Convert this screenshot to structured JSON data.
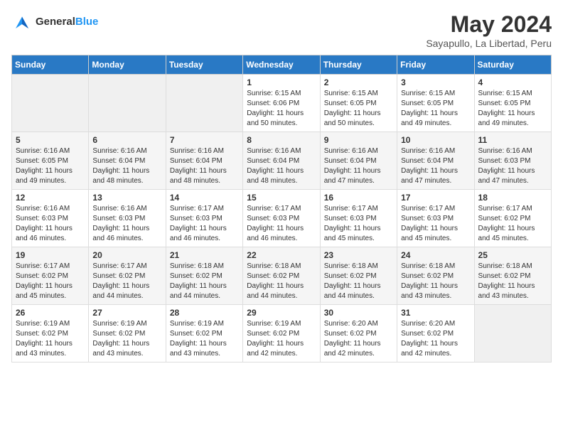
{
  "logo": {
    "text_general": "General",
    "text_blue": "Blue"
  },
  "header": {
    "title": "May 2024",
    "location": "Sayapullo, La Libertad, Peru"
  },
  "weekdays": [
    "Sunday",
    "Monday",
    "Tuesday",
    "Wednesday",
    "Thursday",
    "Friday",
    "Saturday"
  ],
  "weeks": [
    [
      {
        "day": "",
        "info": ""
      },
      {
        "day": "",
        "info": ""
      },
      {
        "day": "",
        "info": ""
      },
      {
        "day": "1",
        "info": "Sunrise: 6:15 AM\nSunset: 6:06 PM\nDaylight: 11 hours\nand 50 minutes."
      },
      {
        "day": "2",
        "info": "Sunrise: 6:15 AM\nSunset: 6:05 PM\nDaylight: 11 hours\nand 50 minutes."
      },
      {
        "day": "3",
        "info": "Sunrise: 6:15 AM\nSunset: 6:05 PM\nDaylight: 11 hours\nand 49 minutes."
      },
      {
        "day": "4",
        "info": "Sunrise: 6:15 AM\nSunset: 6:05 PM\nDaylight: 11 hours\nand 49 minutes."
      }
    ],
    [
      {
        "day": "5",
        "info": "Sunrise: 6:16 AM\nSunset: 6:05 PM\nDaylight: 11 hours\nand 49 minutes."
      },
      {
        "day": "6",
        "info": "Sunrise: 6:16 AM\nSunset: 6:04 PM\nDaylight: 11 hours\nand 48 minutes."
      },
      {
        "day": "7",
        "info": "Sunrise: 6:16 AM\nSunset: 6:04 PM\nDaylight: 11 hours\nand 48 minutes."
      },
      {
        "day": "8",
        "info": "Sunrise: 6:16 AM\nSunset: 6:04 PM\nDaylight: 11 hours\nand 48 minutes."
      },
      {
        "day": "9",
        "info": "Sunrise: 6:16 AM\nSunset: 6:04 PM\nDaylight: 11 hours\nand 47 minutes."
      },
      {
        "day": "10",
        "info": "Sunrise: 6:16 AM\nSunset: 6:04 PM\nDaylight: 11 hours\nand 47 minutes."
      },
      {
        "day": "11",
        "info": "Sunrise: 6:16 AM\nSunset: 6:03 PM\nDaylight: 11 hours\nand 47 minutes."
      }
    ],
    [
      {
        "day": "12",
        "info": "Sunrise: 6:16 AM\nSunset: 6:03 PM\nDaylight: 11 hours\nand 46 minutes."
      },
      {
        "day": "13",
        "info": "Sunrise: 6:16 AM\nSunset: 6:03 PM\nDaylight: 11 hours\nand 46 minutes."
      },
      {
        "day": "14",
        "info": "Sunrise: 6:17 AM\nSunset: 6:03 PM\nDaylight: 11 hours\nand 46 minutes."
      },
      {
        "day": "15",
        "info": "Sunrise: 6:17 AM\nSunset: 6:03 PM\nDaylight: 11 hours\nand 46 minutes."
      },
      {
        "day": "16",
        "info": "Sunrise: 6:17 AM\nSunset: 6:03 PM\nDaylight: 11 hours\nand 45 minutes."
      },
      {
        "day": "17",
        "info": "Sunrise: 6:17 AM\nSunset: 6:03 PM\nDaylight: 11 hours\nand 45 minutes."
      },
      {
        "day": "18",
        "info": "Sunrise: 6:17 AM\nSunset: 6:02 PM\nDaylight: 11 hours\nand 45 minutes."
      }
    ],
    [
      {
        "day": "19",
        "info": "Sunrise: 6:17 AM\nSunset: 6:02 PM\nDaylight: 11 hours\nand 45 minutes."
      },
      {
        "day": "20",
        "info": "Sunrise: 6:17 AM\nSunset: 6:02 PM\nDaylight: 11 hours\nand 44 minutes."
      },
      {
        "day": "21",
        "info": "Sunrise: 6:18 AM\nSunset: 6:02 PM\nDaylight: 11 hours\nand 44 minutes."
      },
      {
        "day": "22",
        "info": "Sunrise: 6:18 AM\nSunset: 6:02 PM\nDaylight: 11 hours\nand 44 minutes."
      },
      {
        "day": "23",
        "info": "Sunrise: 6:18 AM\nSunset: 6:02 PM\nDaylight: 11 hours\nand 44 minutes."
      },
      {
        "day": "24",
        "info": "Sunrise: 6:18 AM\nSunset: 6:02 PM\nDaylight: 11 hours\nand 43 minutes."
      },
      {
        "day": "25",
        "info": "Sunrise: 6:18 AM\nSunset: 6:02 PM\nDaylight: 11 hours\nand 43 minutes."
      }
    ],
    [
      {
        "day": "26",
        "info": "Sunrise: 6:19 AM\nSunset: 6:02 PM\nDaylight: 11 hours\nand 43 minutes."
      },
      {
        "day": "27",
        "info": "Sunrise: 6:19 AM\nSunset: 6:02 PM\nDaylight: 11 hours\nand 43 minutes."
      },
      {
        "day": "28",
        "info": "Sunrise: 6:19 AM\nSunset: 6:02 PM\nDaylight: 11 hours\nand 43 minutes."
      },
      {
        "day": "29",
        "info": "Sunrise: 6:19 AM\nSunset: 6:02 PM\nDaylight: 11 hours\nand 42 minutes."
      },
      {
        "day": "30",
        "info": "Sunrise: 6:20 AM\nSunset: 6:02 PM\nDaylight: 11 hours\nand 42 minutes."
      },
      {
        "day": "31",
        "info": "Sunrise: 6:20 AM\nSunset: 6:02 PM\nDaylight: 11 hours\nand 42 minutes."
      },
      {
        "day": "",
        "info": ""
      }
    ]
  ]
}
